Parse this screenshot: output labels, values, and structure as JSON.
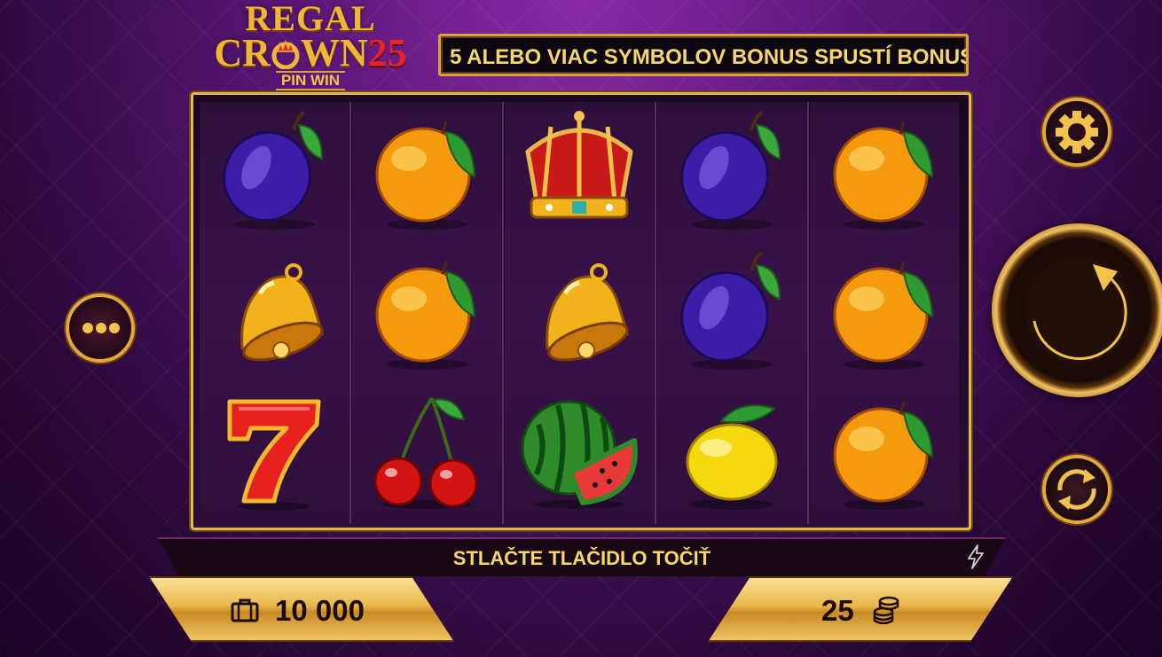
{
  "game": {
    "logo_line1": "REGAL",
    "logo_line2a": "CR",
    "logo_line2b": "WN",
    "logo_number": "25",
    "logo_line3": "PIN WIN"
  },
  "marquee": {
    "text": "5 ALEBO VIAC SYMBOLOV BONUS SPUSTÍ BONUS"
  },
  "reels": [
    [
      "plum",
      "bell",
      "seven"
    ],
    [
      "orange",
      "orange",
      "cherry"
    ],
    [
      "crown",
      "bell",
      "watermelon"
    ],
    [
      "plum",
      "plum",
      "lemon"
    ],
    [
      "orange",
      "orange",
      "orange"
    ]
  ],
  "info": {
    "message": "STLAČTE TLAČIDLO TOČIŤ"
  },
  "balance": {
    "value": "10 000",
    "icon": "briefcase-icon"
  },
  "bet": {
    "value": "25",
    "icon": "coins-icon"
  },
  "buttons": {
    "menu": "more-dots-icon",
    "settings": "gear-icon",
    "spin": "spin-arrow-icon",
    "autoplay": "autoplay-arrows-icon"
  },
  "colors": {
    "gold": "#e8b84c",
    "text_yellow": "#f6d868",
    "bg_purple": "#5a1677"
  }
}
